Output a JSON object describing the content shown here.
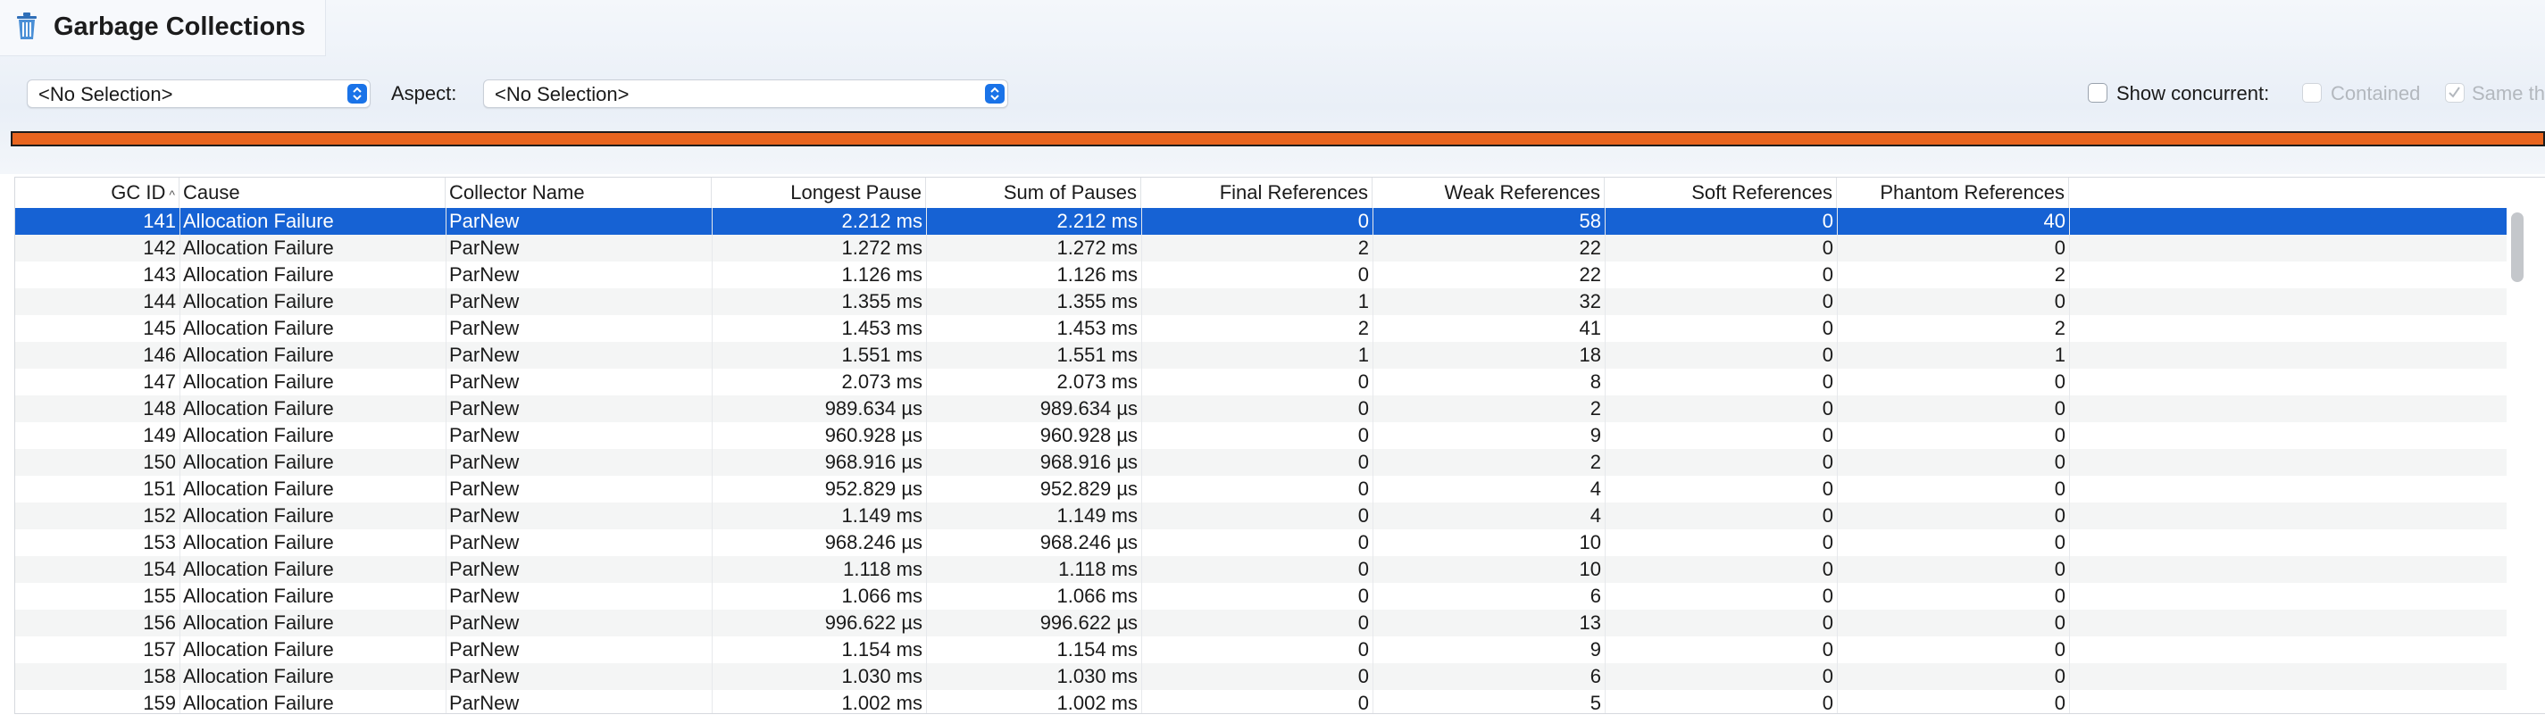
{
  "header": {
    "title": "Garbage Collections",
    "icon": "trash-icon"
  },
  "toolbar": {
    "filter_select": "<No Selection>",
    "aspect_label": "Aspect:",
    "aspect_select": "<No Selection>",
    "show_concurrent_label": "Show concurrent:",
    "show_concurrent_checked": false,
    "contained_label": "Contained",
    "contained_checked": false,
    "same_threads_label": "Same th",
    "same_threads_checked": true
  },
  "timeline": {
    "color": "#e8651f"
  },
  "table": {
    "columns": [
      "GC ID",
      "Cause",
      "Collector Name",
      "Longest Pause",
      "Sum of Pauses",
      "Final References",
      "Weak References",
      "Soft References",
      "Phantom References"
    ],
    "sorted_column": "GC ID",
    "selected_row": 0,
    "rows": [
      [
        "141",
        "Allocation Failure",
        "ParNew",
        "2.212 ms",
        "2.212 ms",
        "0",
        "58",
        "0",
        "40"
      ],
      [
        "142",
        "Allocation Failure",
        "ParNew",
        "1.272 ms",
        "1.272 ms",
        "2",
        "22",
        "0",
        "0"
      ],
      [
        "143",
        "Allocation Failure",
        "ParNew",
        "1.126 ms",
        "1.126 ms",
        "0",
        "22",
        "0",
        "2"
      ],
      [
        "144",
        "Allocation Failure",
        "ParNew",
        "1.355 ms",
        "1.355 ms",
        "1",
        "32",
        "0",
        "0"
      ],
      [
        "145",
        "Allocation Failure",
        "ParNew",
        "1.453 ms",
        "1.453 ms",
        "2",
        "41",
        "0",
        "2"
      ],
      [
        "146",
        "Allocation Failure",
        "ParNew",
        "1.551 ms",
        "1.551 ms",
        "1",
        "18",
        "0",
        "1"
      ],
      [
        "147",
        "Allocation Failure",
        "ParNew",
        "2.073 ms",
        "2.073 ms",
        "0",
        "8",
        "0",
        "0"
      ],
      [
        "148",
        "Allocation Failure",
        "ParNew",
        "989.634 µs",
        "989.634 µs",
        "0",
        "2",
        "0",
        "0"
      ],
      [
        "149",
        "Allocation Failure",
        "ParNew",
        "960.928 µs",
        "960.928 µs",
        "0",
        "9",
        "0",
        "0"
      ],
      [
        "150",
        "Allocation Failure",
        "ParNew",
        "968.916 µs",
        "968.916 µs",
        "0",
        "2",
        "0",
        "0"
      ],
      [
        "151",
        "Allocation Failure",
        "ParNew",
        "952.829 µs",
        "952.829 µs",
        "0",
        "4",
        "0",
        "0"
      ],
      [
        "152",
        "Allocation Failure",
        "ParNew",
        "1.149 ms",
        "1.149 ms",
        "0",
        "4",
        "0",
        "0"
      ],
      [
        "153",
        "Allocation Failure",
        "ParNew",
        "968.246 µs",
        "968.246 µs",
        "0",
        "10",
        "0",
        "0"
      ],
      [
        "154",
        "Allocation Failure",
        "ParNew",
        "1.118 ms",
        "1.118 ms",
        "0",
        "10",
        "0",
        "0"
      ],
      [
        "155",
        "Allocation Failure",
        "ParNew",
        "1.066 ms",
        "1.066 ms",
        "0",
        "6",
        "0",
        "0"
      ],
      [
        "156",
        "Allocation Failure",
        "ParNew",
        "996.622 µs",
        "996.622 µs",
        "0",
        "13",
        "0",
        "0"
      ],
      [
        "157",
        "Allocation Failure",
        "ParNew",
        "1.154 ms",
        "1.154 ms",
        "0",
        "9",
        "0",
        "0"
      ],
      [
        "158",
        "Allocation Failure",
        "ParNew",
        "1.030 ms",
        "1.030 ms",
        "0",
        "6",
        "0",
        "0"
      ],
      [
        "159",
        "Allocation Failure",
        "ParNew",
        "1.002 ms",
        "1.002 ms",
        "0",
        "5",
        "0",
        "0"
      ]
    ]
  }
}
